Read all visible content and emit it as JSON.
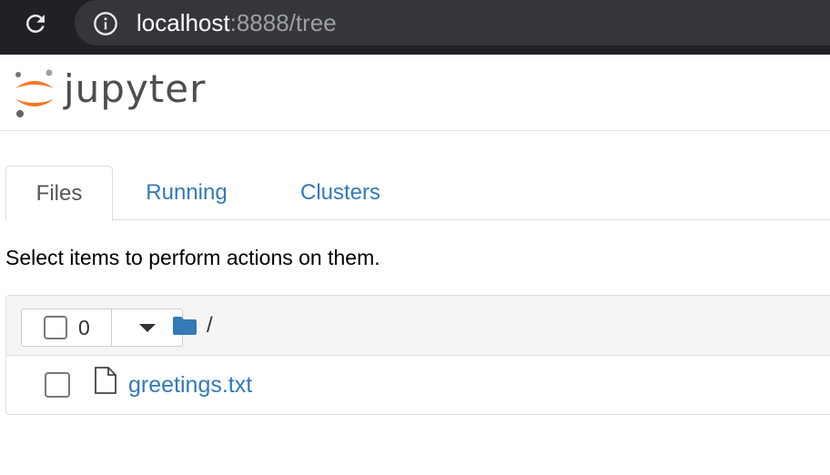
{
  "browser": {
    "url_host": "localhost",
    "url_path": ":8888/tree"
  },
  "header": {
    "logo_text": "jupyter"
  },
  "tabs": [
    {
      "label": "Files"
    },
    {
      "label": "Running"
    },
    {
      "label": "Clusters"
    }
  ],
  "hint": "Select items to perform actions on them.",
  "file_list": {
    "selected_count": "0",
    "breadcrumb": "/",
    "rows": [
      {
        "name": "greetings.txt"
      }
    ]
  },
  "colors": {
    "link": "#337ab7",
    "logo_orange": "#f37726",
    "chrome_bg": "#202124"
  }
}
